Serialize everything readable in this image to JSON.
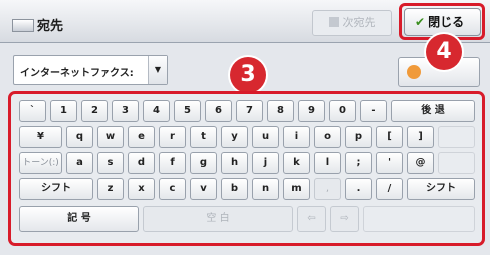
{
  "header": {
    "title": "宛先",
    "next_dest_label": "次宛先",
    "close_label": "閉じる"
  },
  "selector": {
    "value": "インターネットファクス:"
  },
  "side_button": {
    "label": ""
  },
  "annotations": {
    "badge_keyboard": "3",
    "badge_close": "4"
  },
  "keyboard": {
    "row1": [
      "`",
      "1",
      "2",
      "3",
      "4",
      "5",
      "6",
      "7",
      "8",
      "9",
      "0",
      "-"
    ],
    "backspace": "後 退",
    "row2": [
      "¥",
      "q",
      "w",
      "e",
      "r",
      "t",
      "y",
      "u",
      "i",
      "o",
      "p",
      "[",
      "]"
    ],
    "tone": "トーン(:)",
    "row3": [
      "a",
      "s",
      "d",
      "f",
      "g",
      "h",
      "j",
      "k",
      "l",
      ";",
      "'",
      "@"
    ],
    "shift": "シフト",
    "row4": [
      "z",
      "x",
      "c",
      "v",
      "b",
      "n",
      "m",
      ",",
      ".",
      "/"
    ],
    "symbols": "記 号",
    "space": "空 白",
    "left_arrow": "⇦",
    "right_arrow": "⇨"
  }
}
